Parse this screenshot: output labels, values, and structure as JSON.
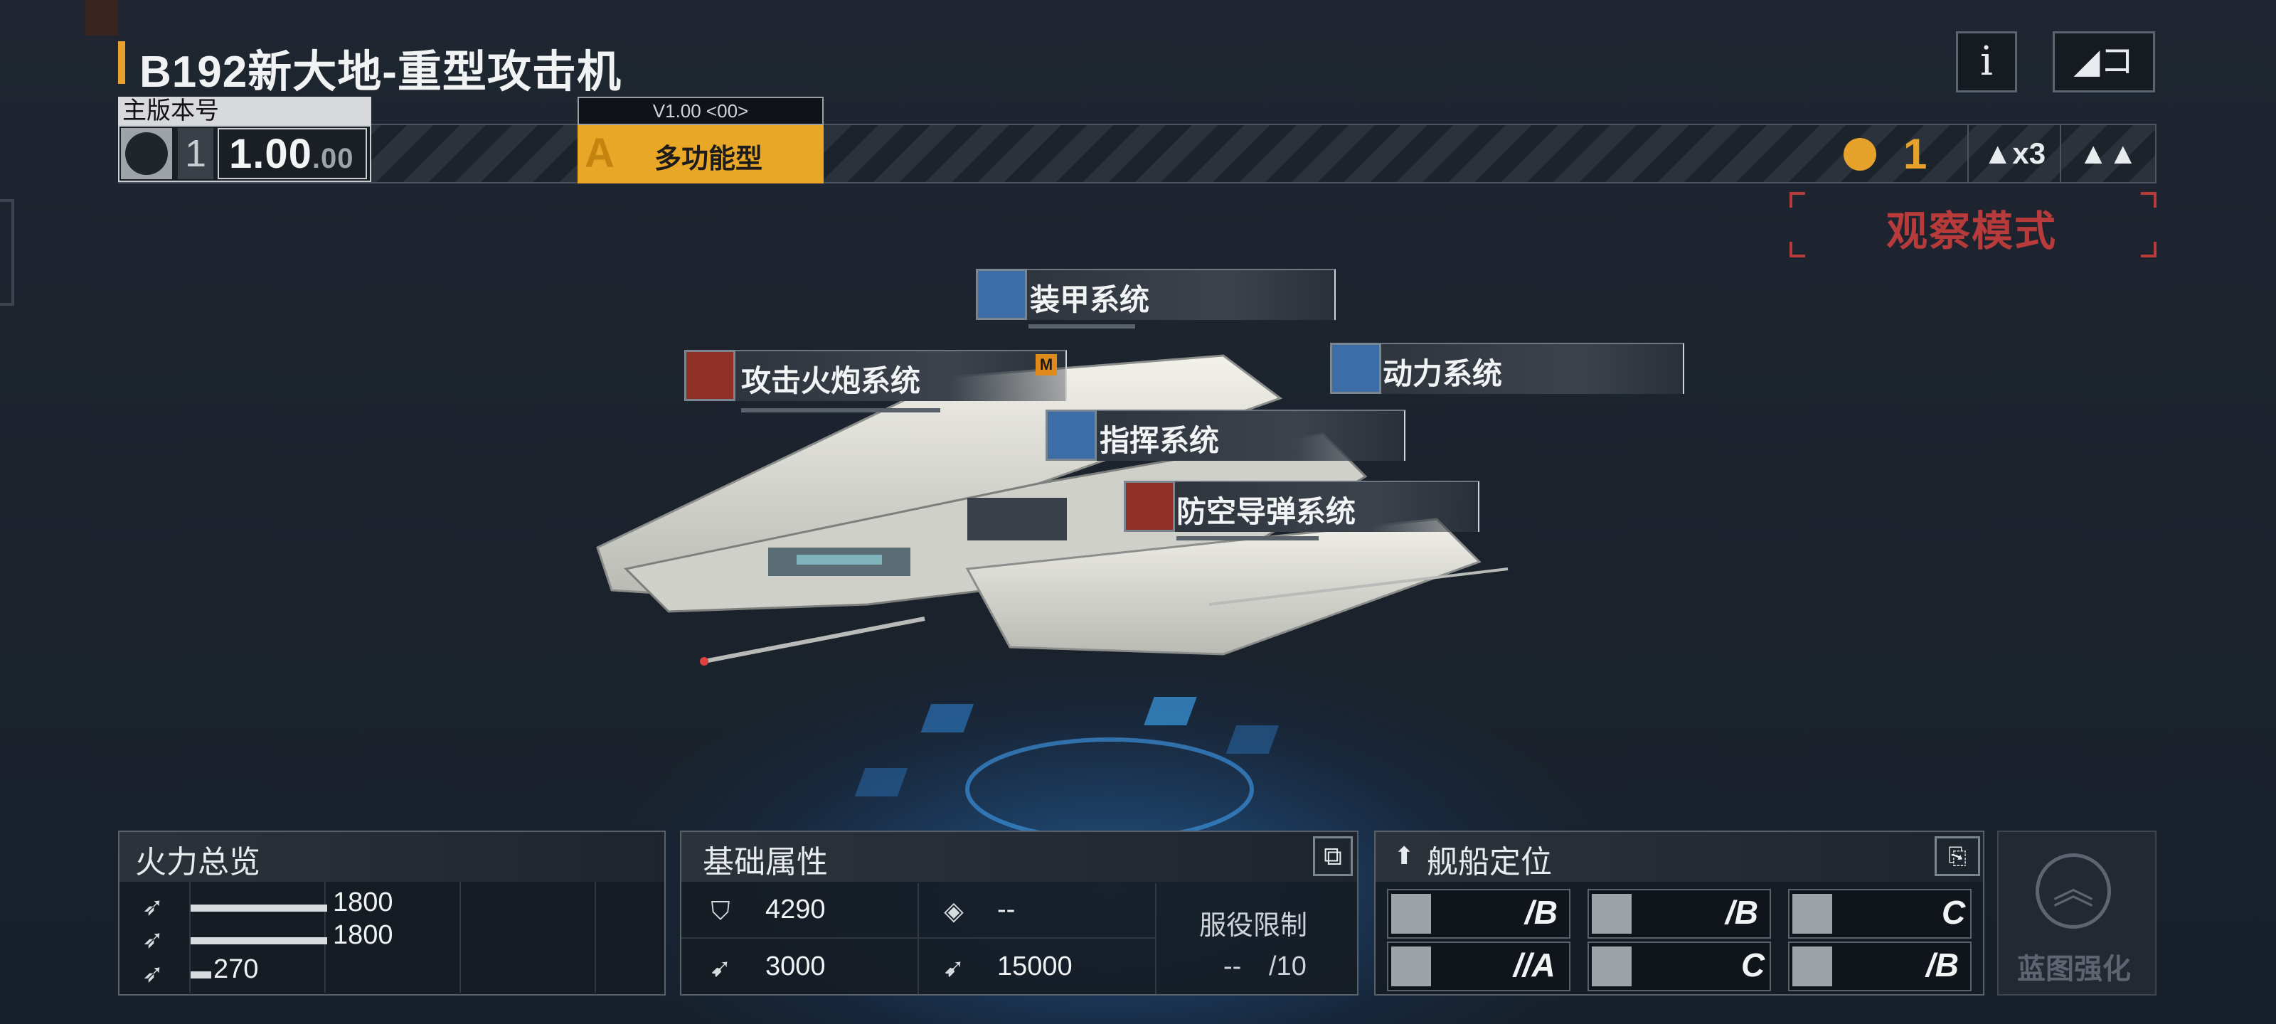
{
  "title": "B192新大地-重型攻击机",
  "top_buttons": {
    "info": "i",
    "back": "◢コ"
  },
  "version": {
    "label": "主版本号",
    "tier": "1",
    "number": "1.00",
    "suffix": ".00",
    "sub_version": "V1.00 <00>"
  },
  "ship_type": {
    "letter": "A",
    "label": "多功能型"
  },
  "medals": {
    "count": "1"
  },
  "upgrade": {
    "label": "▲x3",
    "tri": "▲▲"
  },
  "mode": {
    "label": "观察模式"
  },
  "systems": [
    {
      "label": "装甲系统",
      "icon": "shield-icon"
    },
    {
      "label": "攻击火炮系统",
      "icon": "shell-icon",
      "badge": "M"
    },
    {
      "label": "动力系统",
      "icon": "engine-icon"
    },
    {
      "label": "指挥系统",
      "icon": "radar-icon"
    },
    {
      "label": "防空导弹系统",
      "icon": "missile-icon"
    }
  ],
  "firepower": {
    "title": "火力总览",
    "rows": [
      {
        "icon": "anti-ship-icon",
        "value": "1800",
        "fraction": 1.0
      },
      {
        "icon": "anti-air-icon",
        "value": "1800",
        "fraction": 1.0
      },
      {
        "icon": "siege-icon",
        "value": "270",
        "fraction": 0.15
      }
    ]
  },
  "base_stats": {
    "title": "基础属性",
    "hp": "4290",
    "armor": "--",
    "speed": "3000",
    "warp": "15000",
    "service_label": "服役限制",
    "service_current": "--",
    "service_max": "/10"
  },
  "positioning": {
    "title": "舰船定位",
    "cells": [
      {
        "icon": "anti-ship-icon",
        "grade": "/B"
      },
      {
        "icon": "anti-air-icon",
        "grade": "/B"
      },
      {
        "icon": "siege-icon",
        "grade": "C"
      },
      {
        "icon": "tracking-icon",
        "grade": "//A"
      },
      {
        "icon": "shield-icon",
        "grade": "C"
      },
      {
        "icon": "support-icon",
        "grade": "/B"
      }
    ]
  },
  "enhance": {
    "label": "蓝图强化"
  }
}
